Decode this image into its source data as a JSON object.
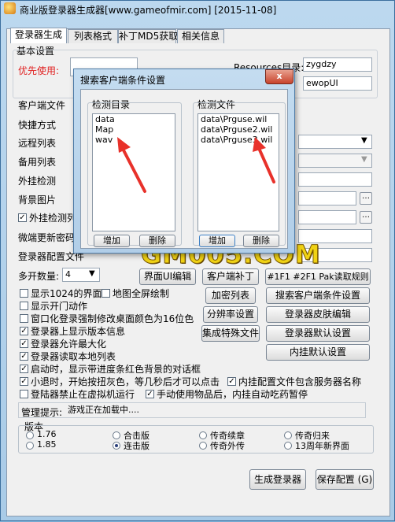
{
  "window": {
    "title": "商业版登录器生成器[www.gameofmir.com] [2015-11-08]"
  },
  "tabs": [
    "登录器生成",
    "列表格式",
    "补丁MD5获取",
    "相关信息"
  ],
  "basic": {
    "group_label": "基本设置",
    "priority_label": "优先使用:",
    "resources_label": "Resources目录:",
    "resources_value": "zygdzy",
    "newopui_value": "ewopUI",
    "client_file_label": "客户端文件",
    "shortcut_label": "快捷方式",
    "remote_list_label": "远程列表",
    "backup_list_label": "备用列表",
    "plugin_detect_label": "外挂检测",
    "bg_image_label": "背景图片",
    "plugin_detect_cb": "外挂检测列",
    "micro_update_label": "微端更新密码",
    "login_config_label": "登录器配置文件",
    "multi_open_label": "多开数量:",
    "multi_open_value": "4"
  },
  "checkboxes": [
    {
      "label": "显示1024的界面",
      "checked": false
    },
    {
      "label": "显示开门动作",
      "checked": false
    },
    {
      "label": "窗口化登录强制修改桌面颜色为16位色",
      "checked": false
    },
    {
      "label": "登录器上显示版本信息",
      "checked": true
    },
    {
      "label": "登录器允许最大化",
      "checked": true
    },
    {
      "label": "登录器读取本地列表",
      "checked": true
    },
    {
      "label": "启动时，显示带进度条红色背景的对话框",
      "checked": true
    },
    {
      "label": "小退时，开始按扭灰色，等几秒后才可以点击",
      "checked": true
    },
    {
      "label": "登陆器禁止在虚拟机运行",
      "checked": false
    }
  ],
  "extra_checkboxes": {
    "fullscreen_map": {
      "label": "地图全屏绘制",
      "checked": false
    },
    "include_server": {
      "label": "内挂配置文件包含服务器名称",
      "checked": true
    },
    "manual_items": {
      "label": "手动使用物品后，内挂自动吃药暂停",
      "checked": true
    }
  },
  "buttons": {
    "ui_edit": "界面UI编辑",
    "client_patch": "客户端补丁",
    "pak_rules": "#1F1 #2F1 Pak读取规则",
    "encrypt_list": "加密列表",
    "search_conditions": "搜索客户端条件设置",
    "resolution": "分辨率设置",
    "skin_edit": "登录器皮肤编辑",
    "integrate_files": "集成特殊文件",
    "default_settings": "登录器默认设置",
    "plugin_default": "内挂默认设置",
    "generate": "生成登录器",
    "save_config": "保存配置 (G)"
  },
  "admin_tip": {
    "label": "管理提示:",
    "value": "游戏正在加载中...."
  },
  "version": {
    "group_label": "版本",
    "options": [
      {
        "label": "1.76",
        "selected": false
      },
      {
        "label": "合击版",
        "selected": false
      },
      {
        "label": "传奇续章",
        "selected": false
      },
      {
        "label": "传奇归来",
        "selected": false
      },
      {
        "label": "1.85",
        "selected": false
      },
      {
        "label": "连击版",
        "selected": true
      },
      {
        "label": "传奇外传",
        "selected": false
      },
      {
        "label": "13周年新界面",
        "selected": false
      }
    ]
  },
  "dialog": {
    "title": "搜索客户端条件设置",
    "close": "x",
    "dir_group": "检测目录",
    "dir_items": [
      "data",
      "Map",
      "wav"
    ],
    "file_group": "检测文件",
    "file_items": [
      "data\\Prguse.wil",
      "data\\Prguse2.wil",
      "data\\Prguse3.wil"
    ],
    "add_dir": "增加",
    "del_dir": "删除",
    "add_file": "增加",
    "del_file": "删除"
  },
  "watermark": "GM005.COM",
  "colors": {
    "accent_red": "#e02020",
    "arrow_red": "#e8312a",
    "watermark": "#f0d214"
  }
}
